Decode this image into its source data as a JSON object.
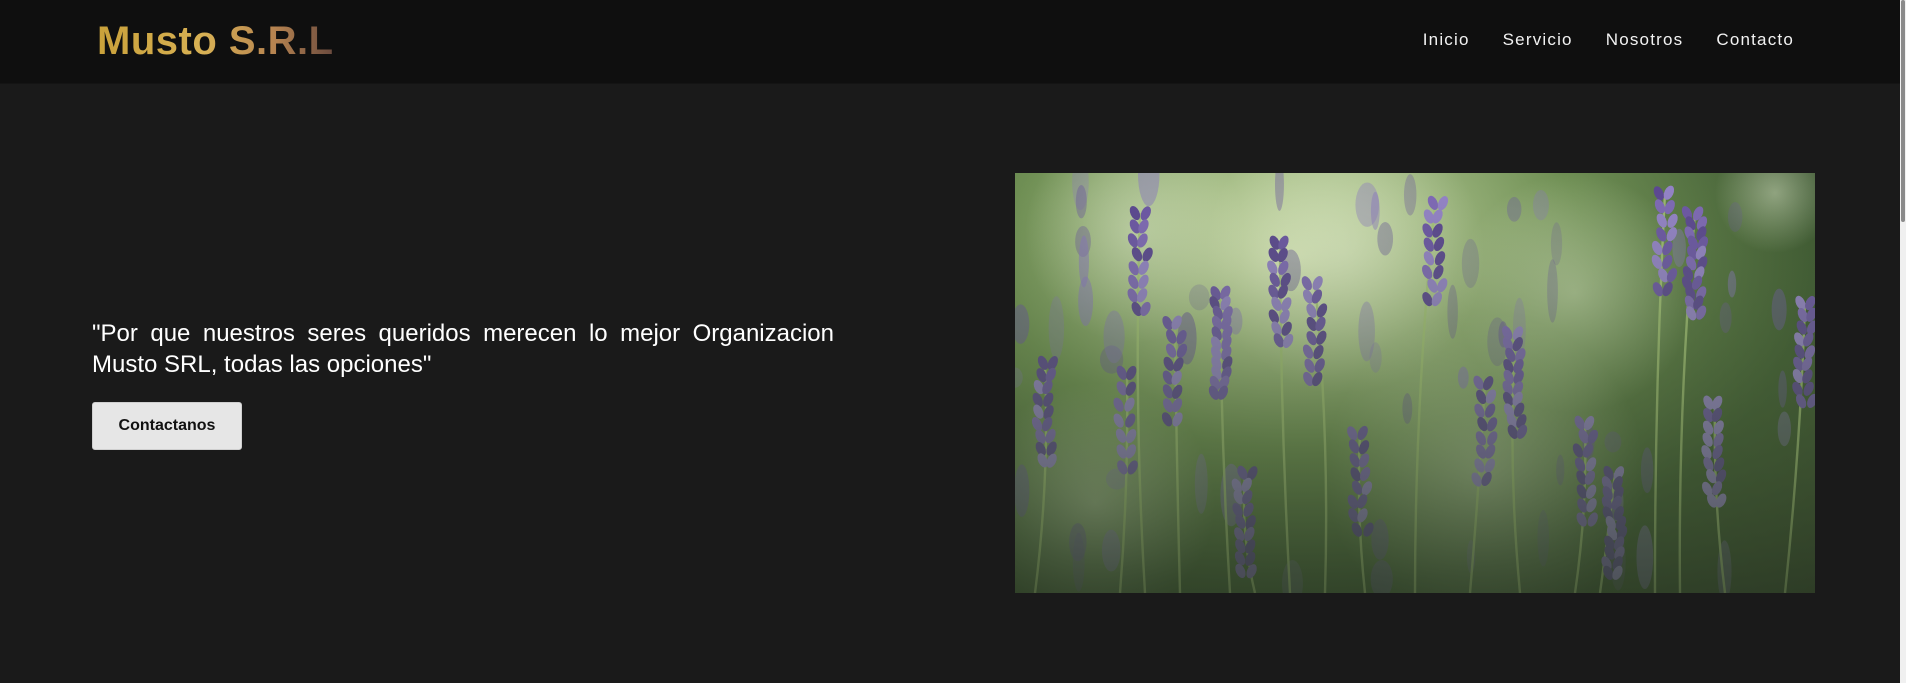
{
  "header": {
    "brand": "Musto S.R.L",
    "nav": [
      {
        "label": "Inicio"
      },
      {
        "label": "Servicio"
      },
      {
        "label": "Nosotros"
      },
      {
        "label": "Contacto"
      }
    ]
  },
  "hero": {
    "quote": "\"Por que nuestros seres queridos merecen lo mejor Organizacion Musto SRL, todas las opciones\"",
    "button_label": "Contactanos",
    "image": {
      "subject": "lavender-flowers-photo"
    }
  },
  "colors": {
    "background": "#1a1a1a",
    "navbar": "#0f0f0f",
    "brand_gold": "#c9a13a",
    "button_bg": "#e6e6e6",
    "lavender": "#7a63b0"
  }
}
